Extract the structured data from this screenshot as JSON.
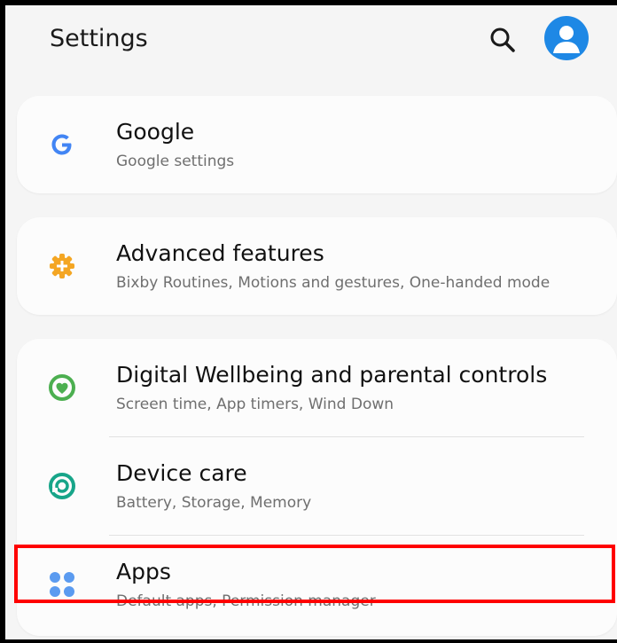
{
  "header": {
    "title": "Settings"
  },
  "icons": {
    "search": "search-icon",
    "account": "account-icon"
  },
  "items": [
    {
      "label": "Google",
      "subtitle": "Google settings",
      "icon": "google-icon",
      "icon_color": "#4285f4"
    },
    {
      "label": "Advanced features",
      "subtitle": "Bixby Routines, Motions and gestures, One-handed mode",
      "icon": "advanced-features-icon",
      "icon_color": "#f4a623"
    },
    {
      "label": "Digital Wellbeing and parental controls",
      "subtitle": "Screen time, App timers, Wind Down",
      "icon": "digital-wellbeing-icon",
      "icon_color": "#4caf50"
    },
    {
      "label": "Device care",
      "subtitle": "Battery, Storage, Memory",
      "icon": "device-care-icon",
      "icon_color": "#17a589"
    },
    {
      "label": "Apps",
      "subtitle": "Default apps, Permission manager",
      "icon": "apps-icon",
      "icon_color": "#5b9bf0"
    }
  ],
  "colors": {
    "accent": "#1e88e5",
    "highlight": "#ff0000",
    "background": "#f5f5f5"
  }
}
